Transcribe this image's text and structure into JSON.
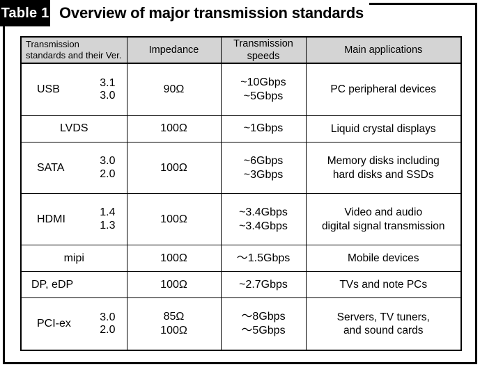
{
  "caption": {
    "tag": "Table 1",
    "title": "Overview of major transmission standards"
  },
  "table": {
    "headers": [
      "Transmission\nstandards and their Ver.",
      "Impedance",
      "Transmission\nspeeds",
      "Main applications"
    ],
    "header_lines": {
      "col1_line1": "Transmission",
      "col1_line2": "standards and their Ver.",
      "col2": "Impedance",
      "col3_line1": "Transmission",
      "col3_line2": "speeds",
      "col4": "Main applications"
    },
    "rows": [
      {
        "standard": "USB",
        "versions": [
          "3.1",
          "3.0"
        ],
        "impedance": [
          "90Ω"
        ],
        "speeds": [
          "~10Gbps",
          "~5Gbps"
        ],
        "applications": [
          "PC peripheral devices"
        ],
        "align": "center"
      },
      {
        "standard": "LVDS",
        "versions": [],
        "impedance": [
          "100Ω"
        ],
        "speeds": [
          "~1Gbps"
        ],
        "applications": [
          "Liquid crystal displays"
        ],
        "align": "center"
      },
      {
        "standard": "SATA",
        "versions": [
          "3.0",
          "2.0"
        ],
        "impedance": [
          "100Ω"
        ],
        "speeds": [
          "~6Gbps",
          "~3Gbps"
        ],
        "applications": [
          "Memory disks including",
          "hard disks and SSDs"
        ],
        "align": "center"
      },
      {
        "standard": "HDMI",
        "versions": [
          "1.4",
          "1.3"
        ],
        "impedance": [
          "100Ω"
        ],
        "speeds": [
          "~3.4Gbps",
          "~3.4Gbps"
        ],
        "applications": [
          "Video and audio",
          "digital signal transmission"
        ],
        "align": "center"
      },
      {
        "standard": "mipi",
        "versions": [],
        "impedance": [
          "100Ω"
        ],
        "speeds": [
          "～1.5Gbps"
        ],
        "applications": [
          "Mobile devices"
        ],
        "align": "center"
      },
      {
        "standard": "DP, eDP",
        "versions": [],
        "impedance": [
          "100Ω"
        ],
        "speeds": [
          "~2.7Gbps"
        ],
        "applications": [
          "TVs and note PCs"
        ],
        "align": "left"
      },
      {
        "standard": "PCI-ex",
        "versions": [
          "3.0",
          "2.0"
        ],
        "impedance": [
          "85Ω",
          "100Ω"
        ],
        "speeds": [
          "～8Gbps",
          "～5Gbps"
        ],
        "applications": [
          "Servers, TV tuners,",
          "and sound cards"
        ],
        "align": "center"
      }
    ]
  },
  "colors": {
    "header_fill": "#d4d4d4",
    "border": "#000000",
    "tag_fill": "#000000",
    "tag_text": "#ffffff",
    "body_fill": "#ffffff"
  }
}
